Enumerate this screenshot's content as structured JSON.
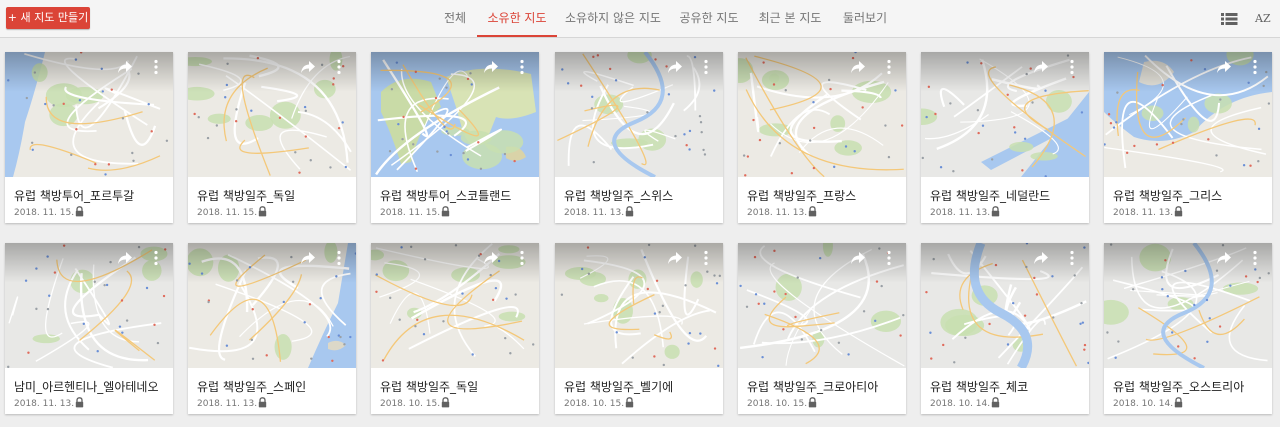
{
  "toolbar": {
    "new_map_label": "+ 새 지도 만들기",
    "tabs": [
      {
        "label": "전체"
      },
      {
        "label": "소유한 지도"
      },
      {
        "label": "소유하지 않은 지도"
      },
      {
        "label": "공유한 지도"
      },
      {
        "label": "최근 본 지도"
      },
      {
        "label": "둘러보기"
      }
    ],
    "active_tab": "소유한 지도",
    "view_icon": "list-view-icon",
    "sort_icon": "sort-az-icon",
    "sort_label": "AZ"
  },
  "colors": {
    "accent": "#db4437",
    "background": "#eeeeee",
    "title_text": "#212121",
    "meta_text": "#757575"
  },
  "maps": [
    {
      "title": "유럽 책방투어_포르투갈",
      "date": "2018. 11. 15.",
      "private": true,
      "style": "coast-west"
    },
    {
      "title": "유럽 책방일주_독일",
      "date": "2018. 11. 15.",
      "private": true,
      "style": "land"
    },
    {
      "title": "유럽 책방투어_스코틀랜드",
      "date": "2018. 11. 15.",
      "private": true,
      "style": "world"
    },
    {
      "title": "유럽 책방일주_스위스",
      "date": "2018. 11. 13.",
      "private": true,
      "style": "city-river"
    },
    {
      "title": "유럽 책방일주_프랑스",
      "date": "2018. 11. 13.",
      "private": true,
      "style": "land"
    },
    {
      "title": "유럽 책방일주_네덜란드",
      "date": "2018. 11. 13.",
      "private": true,
      "style": "harbor"
    },
    {
      "title": "유럽 책방일주_그리스",
      "date": "2018. 11. 13.",
      "private": true,
      "style": "sea-top"
    },
    {
      "title": "남미_아르헨티나_엘아테네오",
      "date": "2018. 11. 13.",
      "private": true,
      "style": "city"
    },
    {
      "title": "유럽 책방일주_스페인",
      "date": "2018. 11. 13.",
      "private": true,
      "style": "coast-east"
    },
    {
      "title": "유럽 책방일주_독일",
      "date": "2018. 10. 15.",
      "private": true,
      "style": "city-green"
    },
    {
      "title": "유럽 책방일주_벨기에",
      "date": "2018. 10. 15.",
      "private": true,
      "style": "land"
    },
    {
      "title": "유럽 책방일주_크로아티아",
      "date": "2018. 10. 15.",
      "private": true,
      "style": "city-grey"
    },
    {
      "title": "유럽 책방일주_체코",
      "date": "2018. 10. 14.",
      "private": true,
      "style": "river-city"
    },
    {
      "title": "유럽 책방일주_오스트리아",
      "date": "2018. 10. 14.",
      "private": true,
      "style": "city-river2"
    }
  ]
}
